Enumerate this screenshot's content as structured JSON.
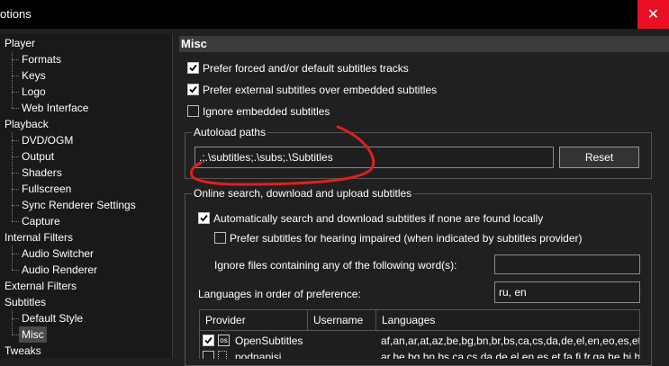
{
  "window": {
    "title": "otions",
    "close_glyph": "✕",
    "close_color": "#e81123"
  },
  "tree": {
    "items": [
      {
        "label": "Player",
        "level": 0
      },
      {
        "label": "Formats",
        "level": 1
      },
      {
        "label": "Keys",
        "level": 1
      },
      {
        "label": "Logo",
        "level": 1
      },
      {
        "label": "Web Interface",
        "level": 1
      },
      {
        "label": "Playback",
        "level": 0
      },
      {
        "label": "DVD/OGM",
        "level": 1
      },
      {
        "label": "Output",
        "level": 1
      },
      {
        "label": "Shaders",
        "level": 1
      },
      {
        "label": "Fullscreen",
        "level": 1
      },
      {
        "label": "Sync Renderer Settings",
        "level": 1
      },
      {
        "label": "Capture",
        "level": 1
      },
      {
        "label": "Internal Filters",
        "level": 0
      },
      {
        "label": "Audio Switcher",
        "level": 1
      },
      {
        "label": "Audio Renderer",
        "level": 1
      },
      {
        "label": "External Filters",
        "level": 0
      },
      {
        "label": "Subtitles",
        "level": 0
      },
      {
        "label": "Default Style",
        "level": 1
      },
      {
        "label": "Misc",
        "level": 1,
        "selected": true
      },
      {
        "label": "Tweaks",
        "level": 0
      }
    ]
  },
  "panel": {
    "header": "Misc",
    "prefer_forced": {
      "label": "Prefer forced and/or default subtitles tracks",
      "checked": true
    },
    "prefer_external": {
      "label": "Prefer external subtitles over embedded subtitles",
      "checked": true
    },
    "ignore_embedded": {
      "label": "Ignore embedded subtitles",
      "checked": false
    },
    "autoload": {
      "group_title": "Autoload paths",
      "value": ".;.\\subtitles;.\\subs;.\\Subtitles",
      "reset_label": "Reset"
    },
    "online": {
      "group_title": "Online search, download and upload subtitles",
      "auto_search": {
        "label": "Automatically search and download subtitles if none are found locally",
        "checked": true
      },
      "prefer_hi": {
        "label": "Prefer subtitles for hearing impaired (when indicated by subtitles provider)",
        "checked": false
      },
      "ignore_words_label": "Ignore files containing any of the following word(s):",
      "ignore_words_value": "",
      "languages_label": "Languages in order of preference:",
      "languages_value": "ru, en",
      "table": {
        "columns": [
          "Provider",
          "Username",
          "Languages"
        ],
        "rows": [
          {
            "checked": true,
            "provider": "OpenSubtitles",
            "username": "",
            "languages": "af,an,ar,at,az,be,bg,bn,br,bs,ca,cs,da,de,el,en,eo,es,et,eu,e"
          },
          {
            "checked": false,
            "provider": "podnapisi",
            "username": "",
            "languages": "ar,be,bg,bn,bs,ca,cs,da,de,el,en,es,et,fa,fi,fr,ga,he,hi,hr,hu,i"
          }
        ]
      }
    }
  },
  "annotation": {
    "color": "#e0201e"
  }
}
